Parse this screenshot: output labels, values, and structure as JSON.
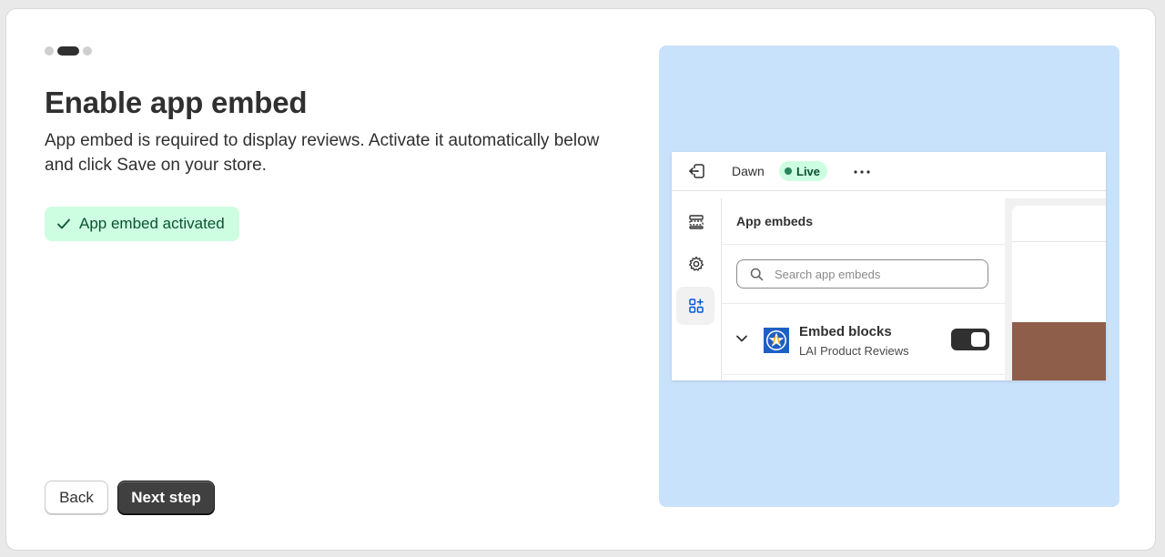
{
  "steps": {
    "total": 3,
    "current": 2
  },
  "title": "Enable app embed",
  "description": "App embed is required to display reviews. Activate it automatically below and click Save on your store.",
  "status_badge": {
    "label": "App embed activated",
    "icon": "check-icon"
  },
  "buttons": {
    "back": "Back",
    "next": "Next step"
  },
  "illustration": {
    "theme_name": "Dawn",
    "live_label": "Live",
    "panel_title": "App embeds",
    "search_placeholder": "Search app embeds",
    "embed": {
      "title": "Embed blocks",
      "subtitle": "LAI Product Reviews",
      "enabled": true
    }
  },
  "colors": {
    "accent_dark": "#303030",
    "success_bg": "#cdfee1",
    "success_text": "#0c5132",
    "illustration_bg": "#c9e2fb"
  }
}
